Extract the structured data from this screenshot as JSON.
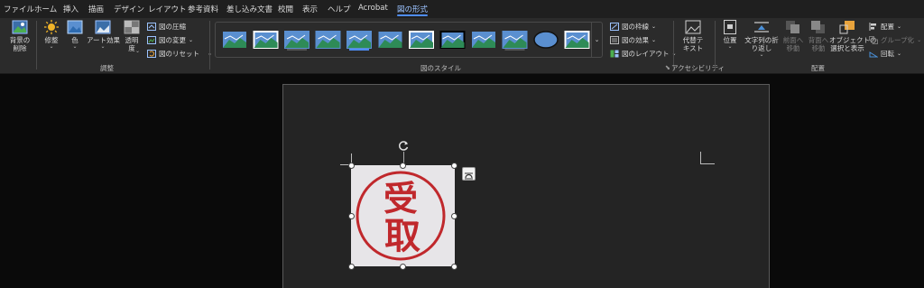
{
  "tabs": [
    "ファイル",
    "ホーム",
    "挿入",
    "描画",
    "デザイン",
    "レイアウト",
    "参考資料",
    "差し込み文書",
    "校閲",
    "表示",
    "ヘルプ",
    "Acrobat",
    "図の形式"
  ],
  "active_tab": "図の形式",
  "adjust": {
    "remove_bg": "背景の\n削除",
    "corrections": "修整",
    "color": "色",
    "artistic": "アート効果",
    "transparency": "透明\n度",
    "compress": "図の圧縮",
    "change": "図の変更",
    "reset": "図のリセット",
    "label": "調整"
  },
  "styles": {
    "label": "図のスタイル",
    "thumb_count": 12,
    "border": "図の枠線",
    "effects": "図の効果",
    "layout": "図のレイアウト"
  },
  "accessibility": {
    "alt_text": "代替テ\nキスト",
    "label": "アクセシビリティ"
  },
  "arrange": {
    "position": "位置",
    "wrap_text": "文字列の折\nり返し",
    "bring_forward": "前面へ\n移動",
    "send_backward": "背面へ\n移動",
    "selection_pane": "オブジェクトの\n選択と表示",
    "align": "配置",
    "group": "グループ化",
    "rotate": "回転",
    "label": "配置"
  },
  "picture": {
    "seal_text_top": "受",
    "seal_text_bottom": "取",
    "seal_color": "#c0282c"
  },
  "colors": {
    "accent": "#4f8df7",
    "icon_orange": "#e8a33c",
    "icon_green": "#2e8b57",
    "icon_blue": "#4a90d9"
  }
}
